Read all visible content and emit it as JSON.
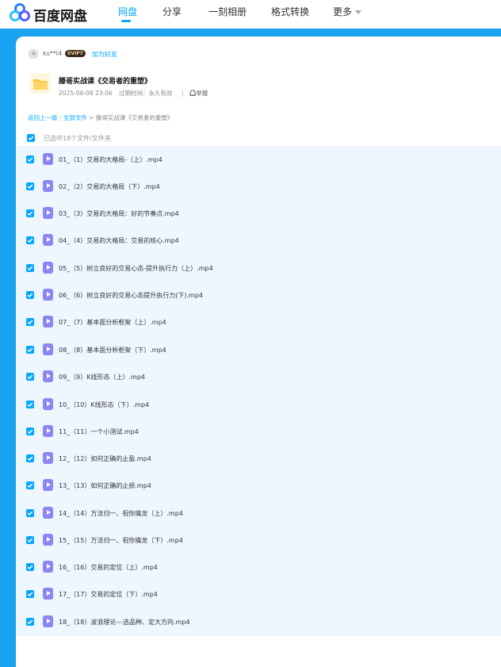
{
  "app": {
    "logo_text": "百度网盘"
  },
  "nav": {
    "items": [
      "网盘",
      "分享",
      "一刻相册",
      "格式转换",
      "更多"
    ],
    "active": "网盘"
  },
  "share": {
    "sharer_name": "ks**l4",
    "vip_badge": "SVIP7",
    "add_friend": "加为好友",
    "title": "滕哥实战课《交易者的重塑》",
    "date": "2025-06-08 23:06",
    "expire": "过期时间：永久有效",
    "report": "举报"
  },
  "breadcrumb": {
    "back": "返回上一级",
    "all_files": "全部文件",
    "separator": ">",
    "current": "滕哥实战课《交易者的重塑》"
  },
  "selection": {
    "text": "已选中18个文件/文件夹"
  },
  "files": [
    "01_（1）交易的大格局-（上）.mp4",
    "02_（2）交易的大格局（下）.mp4",
    "03_（3）交易的大格局：好的节奏点.mp4",
    "04_（4）交易的大格局：交易的核心.mp4",
    "05_（5）树立良好的交易心态-提升执行力（上）.mp4",
    "06_（6）树立良好的交易心态提升执行力(下).mp4",
    "07_（7）基本面分析框架（上）.mp4",
    "08_（8）基本面分析框架（下）.mp4",
    "09_（9）K线形态（上）.mp4",
    "10_（10）K线形态（下）.mp4",
    "11_（11）一个小测试.mp4",
    "12_（12）如何正确的止盈.mp4",
    "13_（13）如何正确的止损.mp4",
    "14_（14）万法归一、祝你擒龙（上）.mp4",
    "15_（15）万法归一、祝你擒龙（下）.mp4",
    "16_（16）交易的定位（上）.mp4",
    "17_（17）交易的定位（下）.mp4",
    "18_（18）波浪理论---选品种、定大方向.mp4"
  ],
  "colors": {
    "accent": "#06a7ff",
    "banner": "#1aa2f2",
    "video_icon": "#8c86f5"
  }
}
